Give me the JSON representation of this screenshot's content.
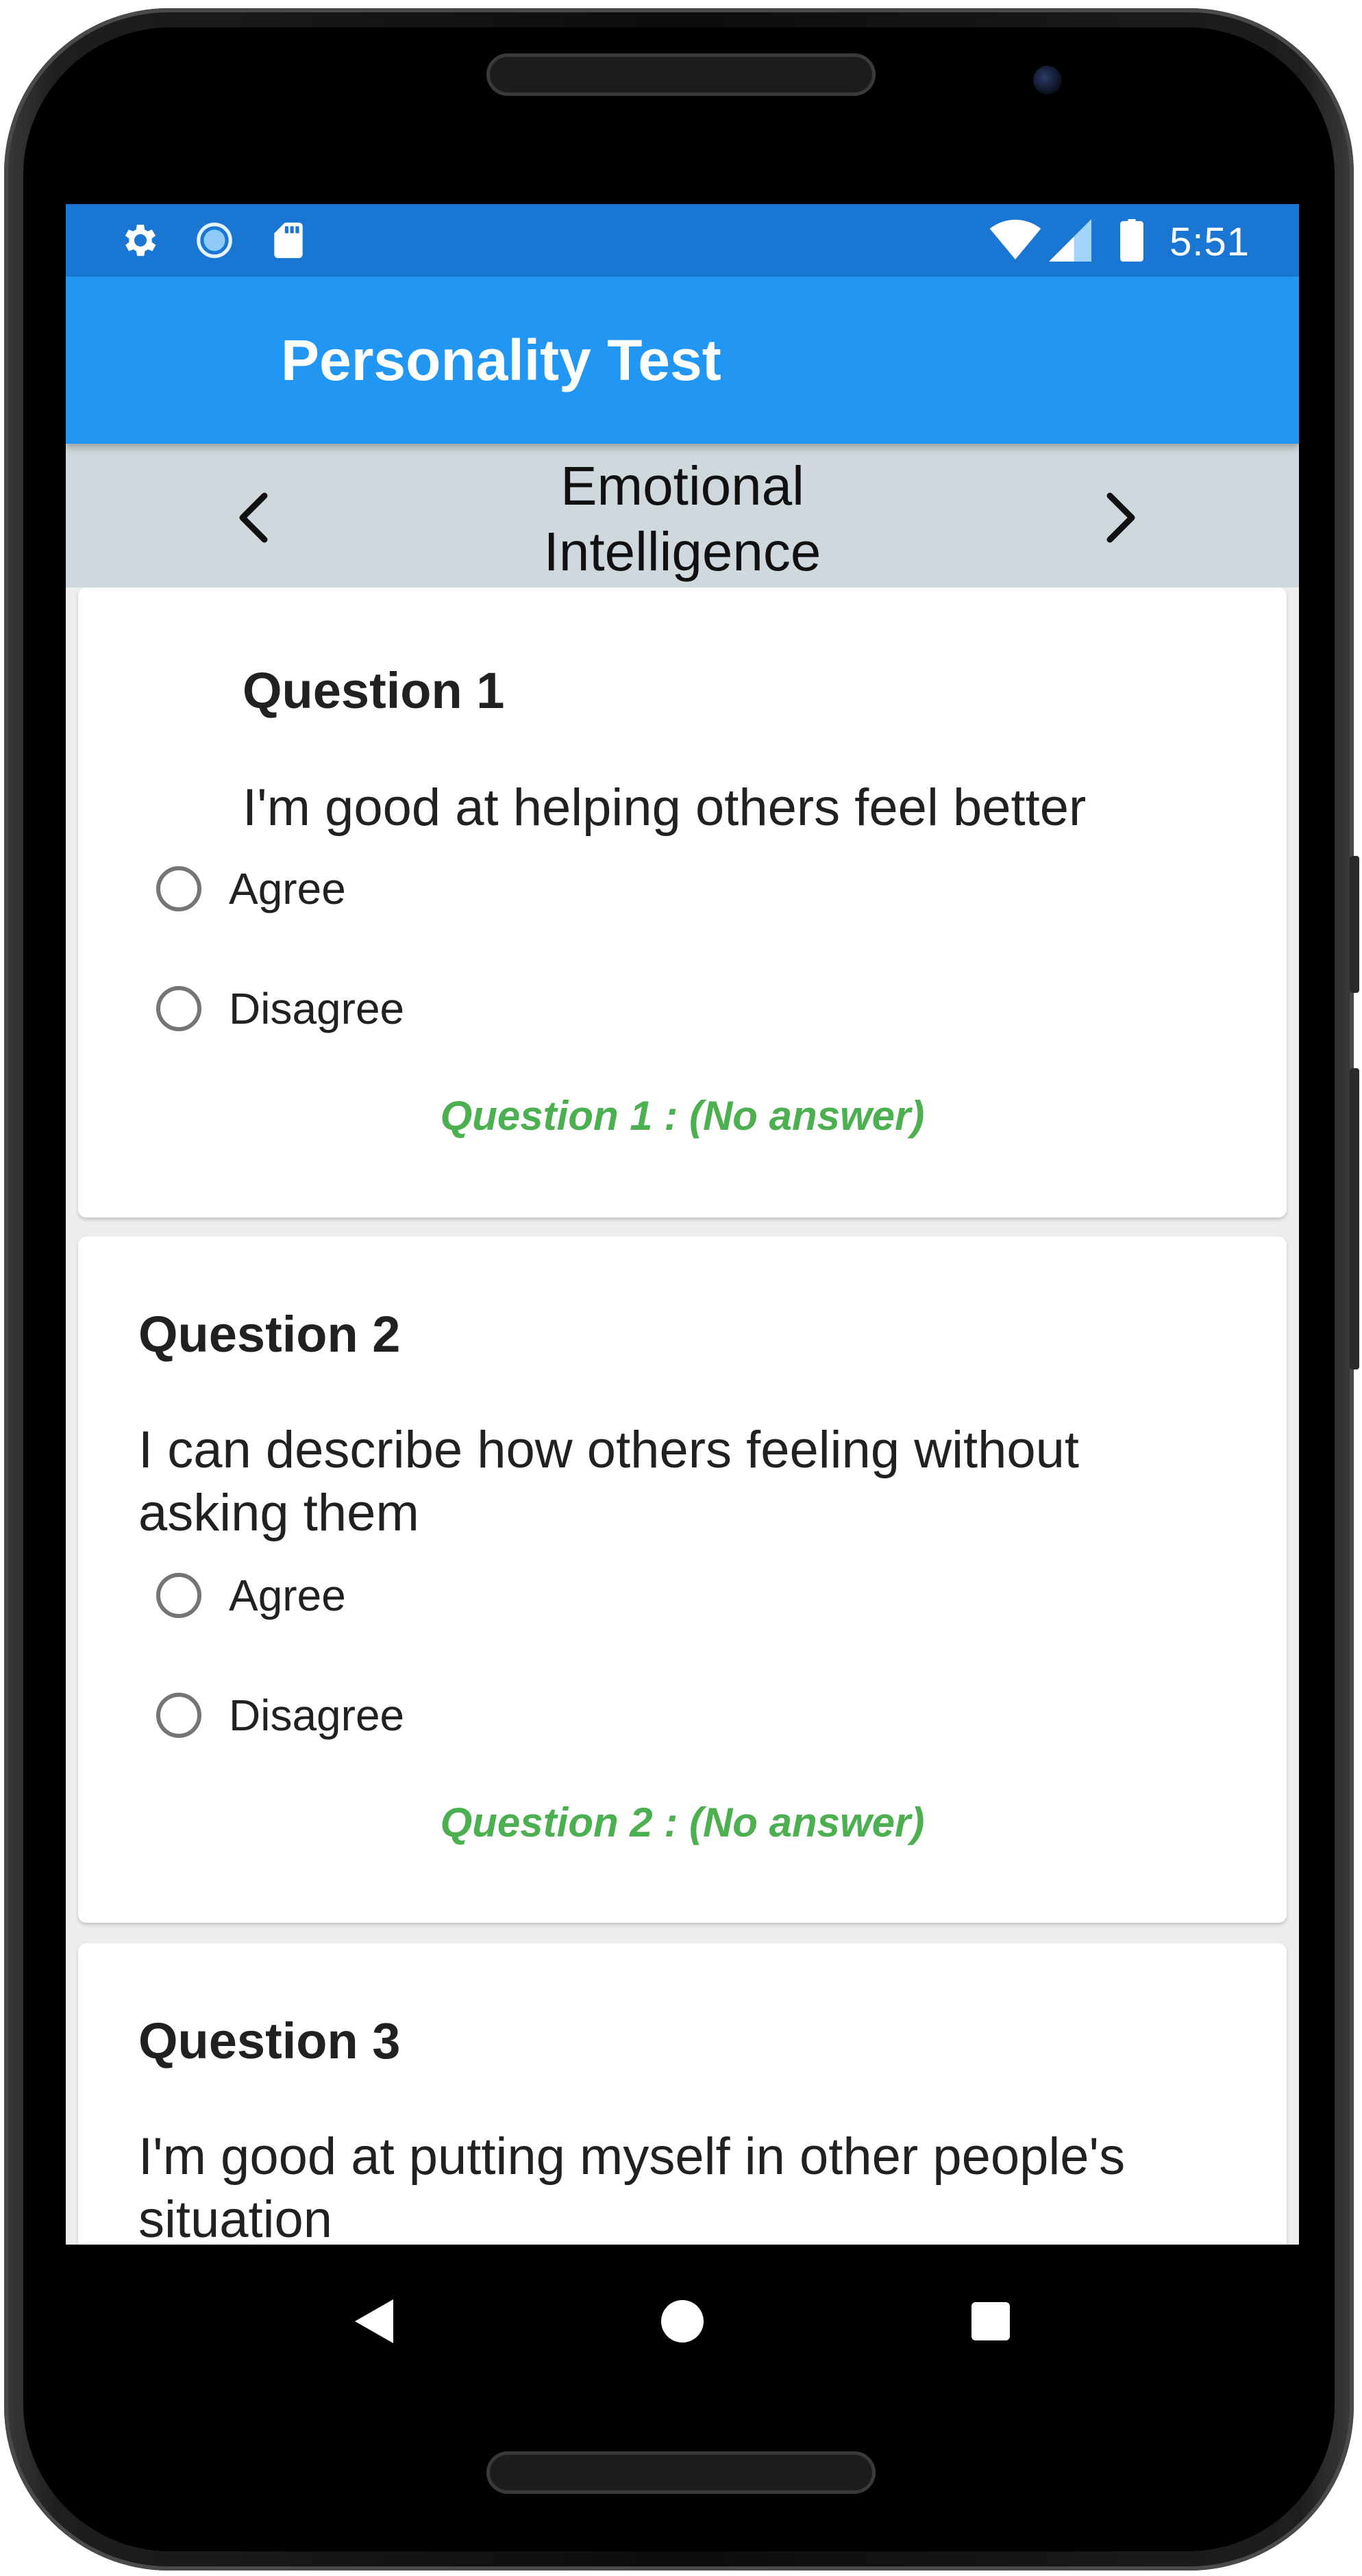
{
  "status_bar": {
    "time": "5:51",
    "left_icons": [
      "gear-icon",
      "sync-icon",
      "sd-card-icon"
    ],
    "right_icons": [
      "wifi-icon",
      "signal-icon",
      "battery-icon"
    ]
  },
  "app_bar": {
    "title": "Personality Test"
  },
  "category_nav": {
    "line1": "Emotional",
    "line2": "Intelligence",
    "prev_icon": "chevron-left-icon",
    "next_icon": "chevron-right-icon"
  },
  "questions": [
    {
      "title": "Question 1",
      "text": "I'm good at helping others feel better",
      "options": [
        "Agree",
        "Disagree"
      ],
      "status": "Question 1 : (No answer)"
    },
    {
      "title": "Question 2",
      "text": "I can describe how others feeling without asking them",
      "options": [
        "Agree",
        "Disagree"
      ],
      "status": "Question 2 : (No answer)"
    },
    {
      "title": "Question 3",
      "text": "I'm good at putting myself in other people's situation"
    }
  ],
  "nav_bar": {
    "icons": [
      "back-icon",
      "home-icon",
      "recents-icon"
    ]
  },
  "colors": {
    "status_bar": "#1976d2",
    "app_bar": "#2196f3",
    "category_bar": "#cfd8dc",
    "answer_status": "#4caf50"
  }
}
